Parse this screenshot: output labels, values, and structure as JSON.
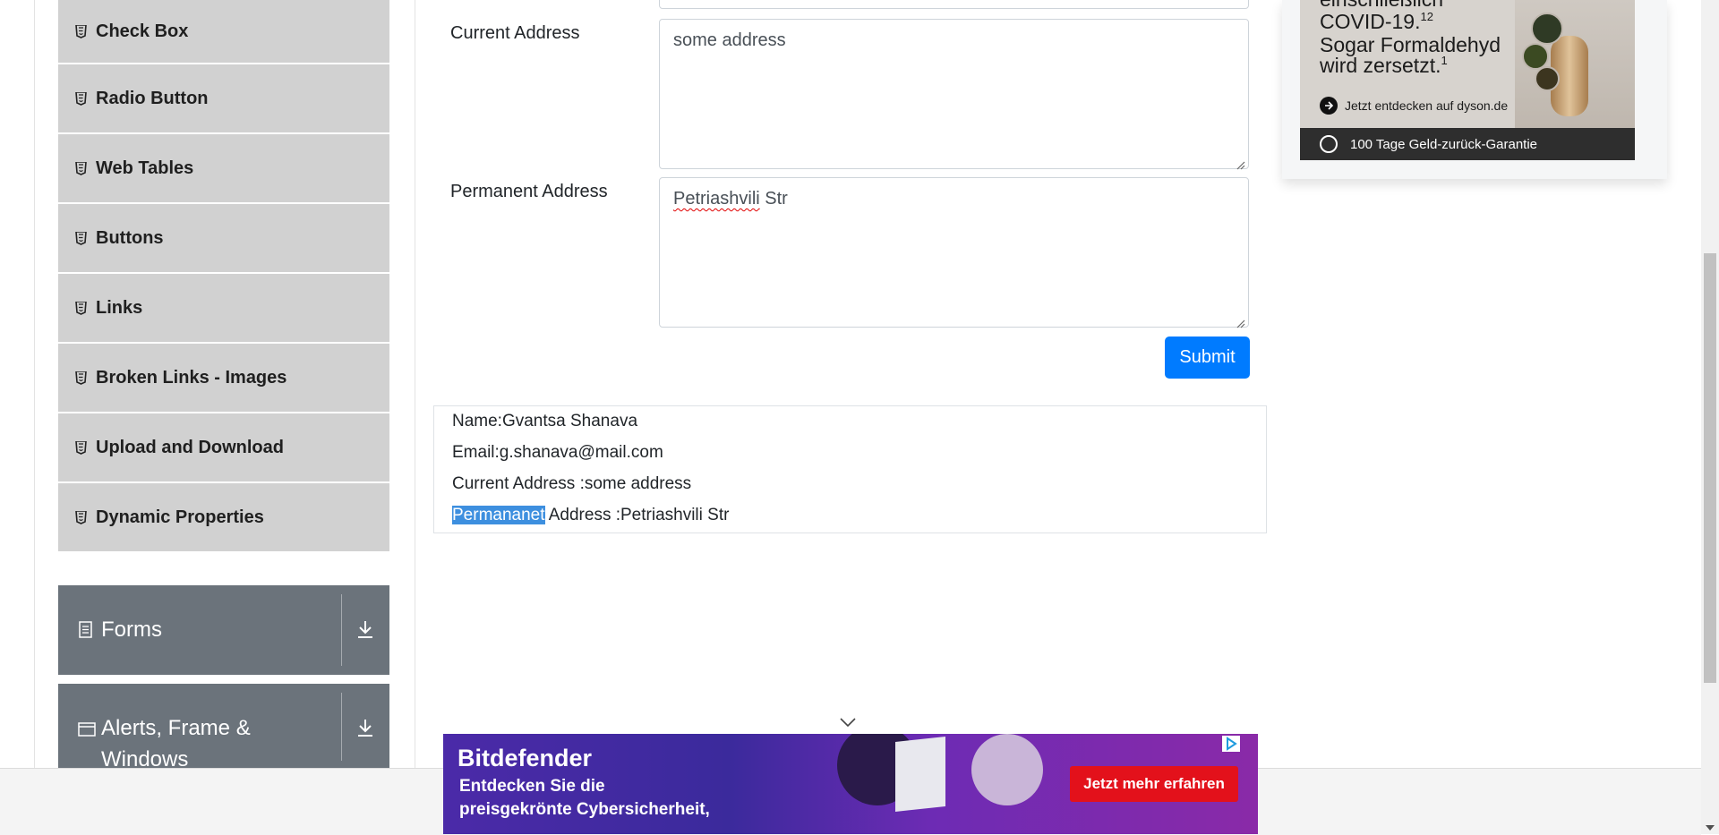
{
  "sidebar": {
    "items": [
      {
        "label": "Check Box"
      },
      {
        "label": "Radio Button"
      },
      {
        "label": "Web Tables"
      },
      {
        "label": "Buttons"
      },
      {
        "label": "Links"
      },
      {
        "label": "Broken Links - Images"
      },
      {
        "label": "Upload and Download"
      },
      {
        "label": "Dynamic Properties"
      }
    ],
    "groups": [
      {
        "label": "Forms",
        "icon": "form-icon"
      },
      {
        "label_line1": "Alerts, Frame &",
        "label_line2": "Windows",
        "icon": "window-icon"
      }
    ]
  },
  "form": {
    "current_address_label": "Current Address",
    "current_address_value": "some address",
    "permanent_address_label": "Permanent Address",
    "permanent_address_value_word1": "Petriashvili",
    "permanent_address_value_word2": " Str",
    "submit_label": "Submit"
  },
  "output": {
    "name": "Name:Gvantsa Shanava",
    "email": "Email:g.shanava@mail.com",
    "current_address": "Current Address :some address",
    "permanent_highlighted": "Permananet",
    "permanent_rest": " Address :Petriashvili Str"
  },
  "right_ad": {
    "line1": "einschließlich",
    "line2": "COVID-19.",
    "line2_sup": "12",
    "line3": "Sogar Formaldehyd",
    "line4": "wird zersetzt.",
    "line4_sup": "1",
    "cta": "Jetzt entdecken auf dyson.de",
    "guarantee": "100 Tage Geld-zurück-Garantie"
  },
  "bottom_ad": {
    "brand": "Bitdefender",
    "headline_line1": "Entdecken Sie die",
    "headline_line2": "preisgekrönte Cybersicherheit,",
    "cta": "Jetzt mehr erfahren"
  },
  "colors": {
    "primary": "#007bff",
    "sidebar_item_bg": "#d1d1d1",
    "group_bg": "#6b737b",
    "highlight": "#3d8fdf",
    "bd_cta": "#e3111b"
  }
}
